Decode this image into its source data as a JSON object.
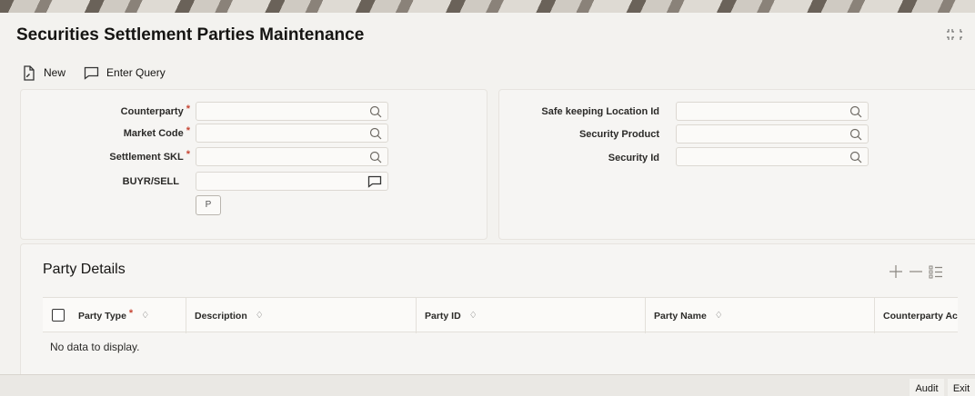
{
  "page": {
    "title": "Securities Settlement Parties Maintenance"
  },
  "toolbar": {
    "new_label": "New",
    "enter_query_label": "Enter Query"
  },
  "form": {
    "counterparty": {
      "label": "Counterparty",
      "value": ""
    },
    "market_code": {
      "label": "Market Code",
      "value": ""
    },
    "settlement_skl": {
      "label": "Settlement SKL",
      "value": ""
    },
    "buyr_sell": {
      "label": "BUYR/SELL",
      "value": ""
    },
    "p_button": "P",
    "safe_keeping_location_id": {
      "label": "Safe keeping Location Id",
      "value": ""
    },
    "security_product": {
      "label": "Security Product",
      "value": ""
    },
    "security_id": {
      "label": "Security Id",
      "value": ""
    },
    "required_mark": "*"
  },
  "party_details": {
    "title": "Party Details",
    "columns": {
      "party_type": "Party Type",
      "description": "Description",
      "party_id": "Party ID",
      "party_name": "Party Name",
      "counterparty_account": "Counterparty Account"
    },
    "sort_glyph": "♢",
    "empty_message": "No data to display."
  },
  "footer": {
    "audit_label": "Audit",
    "exit_label": "Exit"
  },
  "icons": [
    "new-document-icon",
    "enter-query-icon",
    "search-icon",
    "comment-icon",
    "add-icon",
    "remove-icon",
    "column-settings-icon",
    "maximize-icon"
  ],
  "colors": {
    "required": "#c74634",
    "background": "#f3f2ef",
    "panel": "#f6f5f3"
  }
}
